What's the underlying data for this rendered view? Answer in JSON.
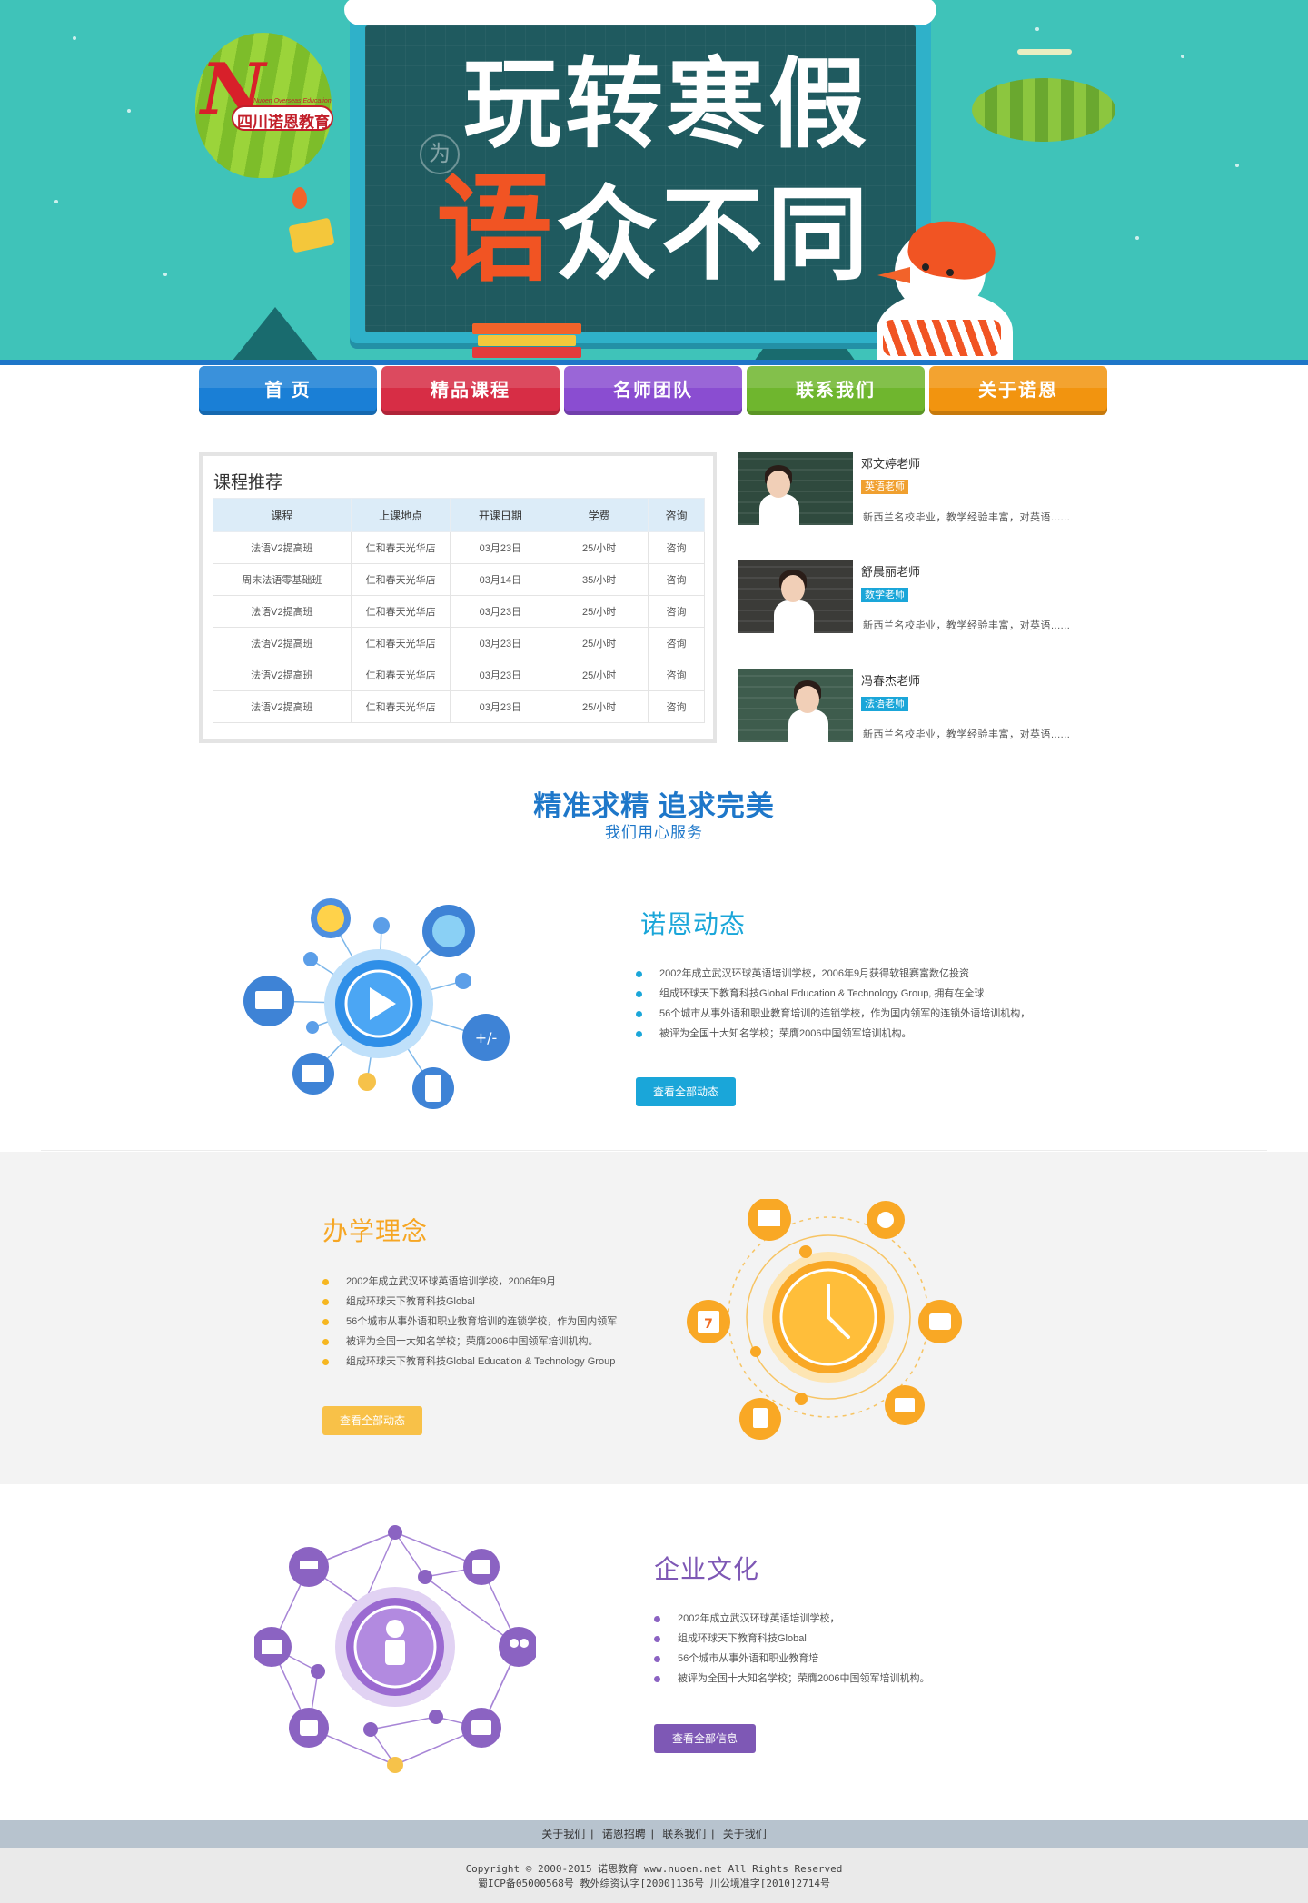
{
  "colors": {
    "hero_bg": "#3fc3b9",
    "accent_blue": "#1e77c9",
    "news_accent": "#1aa6d9",
    "philosophy_accent": "#f6a623",
    "culture_accent": "#7e58b5"
  },
  "hero": {
    "logo_text": "四川诺恩教育",
    "logo_sub": "Nuoen Overseas Education",
    "line1": "玩转寒假",
    "line2_highlight": "语",
    "line2_rest": "众不同",
    "badge": "为"
  },
  "nav": {
    "items": [
      {
        "label": "首  页",
        "color": "#1a7fd6"
      },
      {
        "label": "精品课程",
        "color": "#d72d45"
      },
      {
        "label": "名师团队",
        "color": "#8a4dd1"
      },
      {
        "label": "联系我们",
        "color": "#6fb62e"
      },
      {
        "label": "关于诺恩",
        "color": "#f2940f"
      }
    ]
  },
  "courses": {
    "title": "课程推荐",
    "headers": [
      "课程",
      "上课地点",
      "开课日期",
      "学费",
      "咨询"
    ],
    "rows": [
      [
        "法语V2提高班",
        "仁和春天光华店",
        "03月23日",
        "25/小时",
        "咨询"
      ],
      [
        "周末法语零基础班",
        "仁和春天光华店",
        "03月14日",
        "35/小时",
        "咨询"
      ],
      [
        "法语V2提高班",
        "仁和春天光华店",
        "03月23日",
        "25/小时",
        "咨询"
      ],
      [
        "法语V2提高班",
        "仁和春天光华店",
        "03月23日",
        "25/小时",
        "咨询"
      ],
      [
        "法语V2提高班",
        "仁和春天光华店",
        "03月23日",
        "25/小时",
        "咨询"
      ],
      [
        "法语V2提高班",
        "仁和春天光华店",
        "03月23日",
        "25/小时",
        "咨询"
      ]
    ]
  },
  "teachers": [
    {
      "name": "邓文婷老师",
      "tag": "英语老师",
      "tag_color": "#f0a030",
      "desc": "新西兰名校毕业，教学经验丰富，对英语......"
    },
    {
      "name": "舒晨丽老师",
      "tag": "数学老师",
      "tag_color": "#1aa6d9",
      "desc": "新西兰名校毕业，教学经验丰富，对英语......"
    },
    {
      "name": "冯春杰老师",
      "tag": "法语老师",
      "tag_color": "#1aa6d9",
      "desc": "新西兰名校毕业，教学经验丰富，对英语......"
    }
  ],
  "slogan": {
    "main": "精准求精 追求完美",
    "sub": "我们用心服务"
  },
  "news": {
    "title": "诺恩动态",
    "items": [
      "2002年成立武汉环球英语培训学校，2006年9月获得软银赛富数亿投资",
      "组成环球天下教育科技Global Education & Technology Group, 拥有在全球",
      "56个城市从事外语和职业教育培训的连锁学校，作为国内领军的连锁外语培训机构，",
      "被评为全国十大知名学校；荣膺2006中国领军培训机构。"
    ],
    "button": "查看全部动态"
  },
  "philosophy": {
    "title": "办学理念",
    "items": [
      "2002年成立武汉环球英语培训学校，2006年9月",
      "组成环球天下教育科技Global",
      "56个城市从事外语和职业教育培训的连锁学校，作为国内领军",
      "被评为全国十大知名学校；荣膺2006中国领军培训机构。",
      "组成环球天下教育科技Global Education & Technology Group"
    ],
    "button": "查看全部动态"
  },
  "culture": {
    "title": "企业文化",
    "items": [
      "2002年成立武汉环球英语培训学校，",
      "组成环球天下教育科技Global",
      "56个城市从事外语和职业教育培",
      "被评为全国十大知名学校；荣膺2006中国领军培训机构。"
    ],
    "button": "查看全部信息"
  },
  "icons": {
    "news_center": "play-icon",
    "news_nodes": [
      "lightbulb-icon",
      "chat-icon",
      "globe-icon",
      "lock-icon",
      "cloud-calc-icon",
      "phone-chart-icon",
      "cake-icon",
      "book-icon",
      "chip-icon",
      "monitor-code-icon",
      "mail-icon"
    ],
    "phil_center": "clock-icon",
    "phil_nodes": [
      "book-icon",
      "thumbs-up-icon",
      "note-icon",
      "calendar-icon",
      "mailbox-icon",
      "tablet-icon",
      "heart-icon",
      "video-icon",
      "play-small-icon"
    ],
    "culture_center": "user-briefcase-icon",
    "culture_nodes": [
      "cloud-icon",
      "pie-chart-icon",
      "id-card-icon",
      "mobile-icon",
      "presentation-icon",
      "users-icon",
      "code-icon",
      "marker-icon",
      "message-icon",
      "hand-icon",
      "email-icon",
      "thumb-icon"
    ]
  },
  "footer": {
    "links": [
      "关于我们",
      "诺恩招聘",
      "联系我们",
      "关于我们"
    ],
    "copyright": "Copyright © 2000-2015 诺恩教育 www.nuoen.net All Rights Reserved",
    "icp": "蜀ICP备05000568号 教外综资认字[2000]136号 川公境准字[2010]2714号"
  }
}
